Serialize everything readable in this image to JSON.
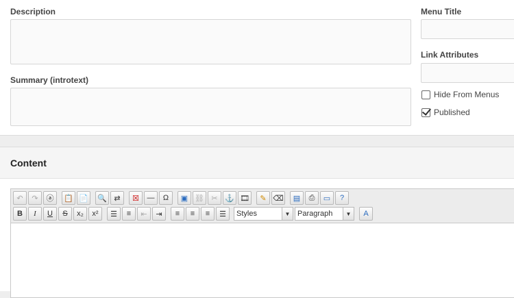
{
  "form": {
    "description_label": "Description",
    "summary_label": "Summary (introtext)",
    "menu_title_label": "Menu Title",
    "link_attributes_label": "Link Attributes",
    "hide_from_menus_label": "Hide From Menus",
    "hide_from_menus_checked": false,
    "published_label": "Published",
    "published_checked": true
  },
  "content": {
    "title": "Content"
  },
  "toolbar": {
    "styles_value": "Styles",
    "format_value": "Paragraph",
    "bold": "B",
    "italic": "I",
    "underline": "U",
    "strike": "S",
    "subscript": "x₂",
    "superscript": "x²",
    "omega": "Ω"
  },
  "colors": {
    "panel_bg": "#ffffff",
    "page_bg": "#eeeeee",
    "toolbar_bg": "#ececec"
  }
}
